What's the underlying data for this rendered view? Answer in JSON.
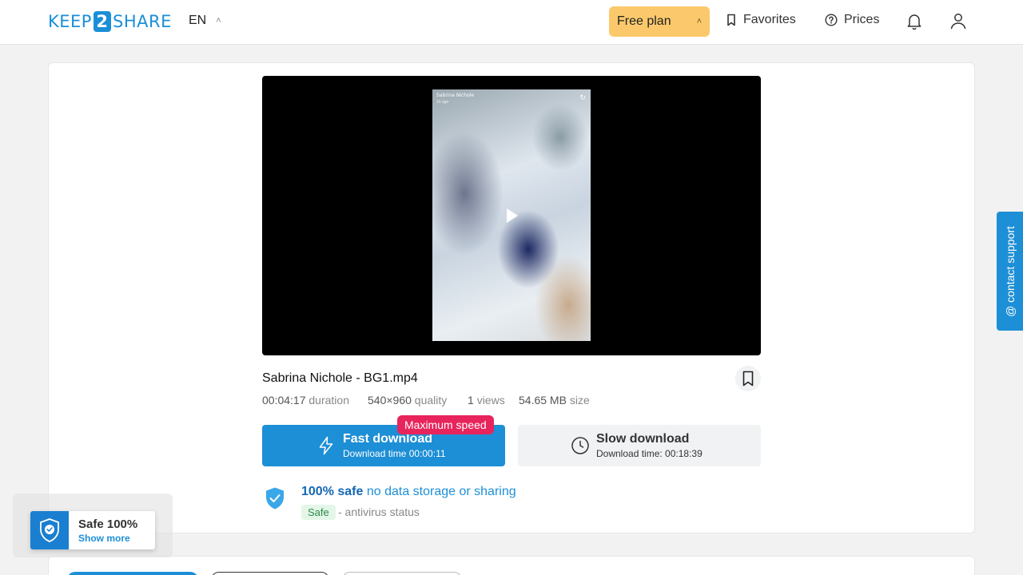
{
  "header": {
    "logo_left": "KEEP",
    "logo_mid": "2",
    "logo_right": "SHARE",
    "language": "EN",
    "plan_label": "Free plan",
    "favorites_label": "Favorites",
    "prices_label": "Prices"
  },
  "video": {
    "overlay_title": "Sabrina Nichole",
    "overlay_sub": "1h ago"
  },
  "file": {
    "name": "Sabrina Nichole - BG1.mp4",
    "duration": "00:04:17",
    "duration_label": "duration",
    "quality": "540×960",
    "quality_label": "quality",
    "views": "1",
    "views_label": "views",
    "size": "54.65 MB",
    "size_label": "size"
  },
  "downloads": {
    "badge": "Maximum speed",
    "fast_title": "Fast download",
    "fast_time": "Download time 00:00:11",
    "slow_title": "Slow download",
    "slow_time": "Download time: 00:18:39"
  },
  "safety": {
    "strong": "100% safe",
    "rest": "no data storage or sharing",
    "tag": "Safe",
    "antivirus": "- antivirus status"
  },
  "support": {
    "label": "@ contact support"
  },
  "safe_widget": {
    "title": "Safe 100%",
    "link": "Show more"
  },
  "colors": {
    "accent": "#1d8fd6",
    "plan": "#fbc96b",
    "badge": "#e8245c",
    "safe_tag_bg": "#e3f6e8"
  },
  "icons": [
    "bookmark-icon",
    "help-circle-icon",
    "bell-icon",
    "user-icon",
    "lightning-icon",
    "clock-icon",
    "shield-check-icon",
    "play-icon"
  ]
}
